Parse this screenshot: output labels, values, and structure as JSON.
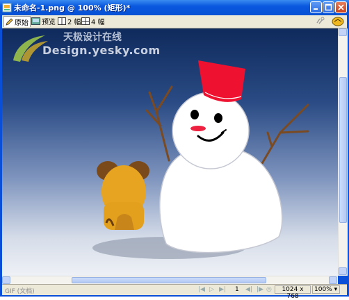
{
  "window": {
    "title": "未命名-1.png @ 100% (矩形)*",
    "icon": "document-icon"
  },
  "toolbar": {
    "tabs": [
      {
        "label": "原始",
        "icon": "pencil-icon",
        "active": true
      },
      {
        "label": "预览",
        "icon": "preview-icon",
        "active": false
      },
      {
        "label": "2 幅",
        "icon": "two-up-icon",
        "active": false
      },
      {
        "label": "4 幅",
        "icon": "four-up-icon",
        "active": false
      }
    ]
  },
  "watermark": {
    "chinese": "天极设计在线",
    "english": "Design.yesky.com"
  },
  "status": {
    "format": "GIF (文档)",
    "page": "1",
    "canvas_size": "1024 x 768",
    "zoom": "100%"
  }
}
